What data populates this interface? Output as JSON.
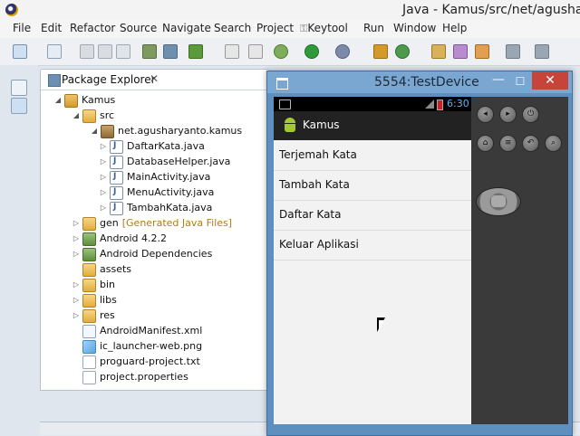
{
  "window": {
    "title": "Java - Kamus/src/net/agushary"
  },
  "menubar": [
    "File",
    "Edit",
    "Refactor",
    "Source",
    "Navigate",
    "Search",
    "Project",
    "Keytool",
    "Run",
    "Window",
    "Help"
  ],
  "package_explorer": {
    "tab_label": "Package Explorer",
    "tree": [
      {
        "label": "Kamus",
        "depth": 0,
        "icon": "project-icon",
        "arrow": "expanded"
      },
      {
        "label": "src",
        "depth": 1,
        "icon": "source-folder-icon",
        "arrow": "expanded"
      },
      {
        "label": "net.agusharyanto.kamus",
        "depth": 2,
        "icon": "package-icon",
        "arrow": "expanded"
      },
      {
        "label": "DaftarKata.java",
        "depth": 3,
        "icon": "java-file-icon",
        "arrow": "collapsed"
      },
      {
        "label": "DatabaseHelper.java",
        "depth": 3,
        "icon": "java-file-icon",
        "arrow": "collapsed"
      },
      {
        "label": "MainActivity.java",
        "depth": 3,
        "icon": "java-file-icon",
        "arrow": "collapsed"
      },
      {
        "label": "MenuActivity.java",
        "depth": 3,
        "icon": "java-file-icon",
        "arrow": "collapsed"
      },
      {
        "label": "TambahKata.java",
        "depth": 3,
        "icon": "java-file-icon",
        "arrow": "collapsed"
      },
      {
        "label": "gen",
        "note": "[Generated Java Files]",
        "depth": 1,
        "icon": "source-folder-icon",
        "arrow": "collapsed"
      },
      {
        "label": "Android 4.2.2",
        "depth": 1,
        "icon": "library-icon",
        "arrow": "collapsed"
      },
      {
        "label": "Android Dependencies",
        "depth": 1,
        "icon": "library-icon",
        "arrow": "collapsed"
      },
      {
        "label": "assets",
        "depth": 1,
        "icon": "folder-icon",
        "arrow": "none"
      },
      {
        "label": "bin",
        "depth": 1,
        "icon": "folder-icon",
        "arrow": "collapsed"
      },
      {
        "label": "libs",
        "depth": 1,
        "icon": "folder-icon",
        "arrow": "collapsed"
      },
      {
        "label": "res",
        "depth": 1,
        "icon": "folder-icon",
        "arrow": "collapsed"
      },
      {
        "label": "AndroidManifest.xml",
        "depth": 1,
        "icon": "xml-file-icon",
        "arrow": "none"
      },
      {
        "label": "ic_launcher-web.png",
        "depth": 1,
        "icon": "image-file-icon",
        "arrow": "none"
      },
      {
        "label": "proguard-project.txt",
        "depth": 1,
        "icon": "text-file-icon",
        "arrow": "none"
      },
      {
        "label": "project.properties",
        "depth": 1,
        "icon": "text-file-icon",
        "arrow": "none"
      }
    ]
  },
  "emulator": {
    "title": "5554:TestDevice",
    "clock": "6:30",
    "app_title": "Kamus",
    "menu_items": [
      "Terjemah Kata",
      "Tambah Kata",
      "Daftar Kata",
      "Keluar Aplikasi"
    ]
  }
}
